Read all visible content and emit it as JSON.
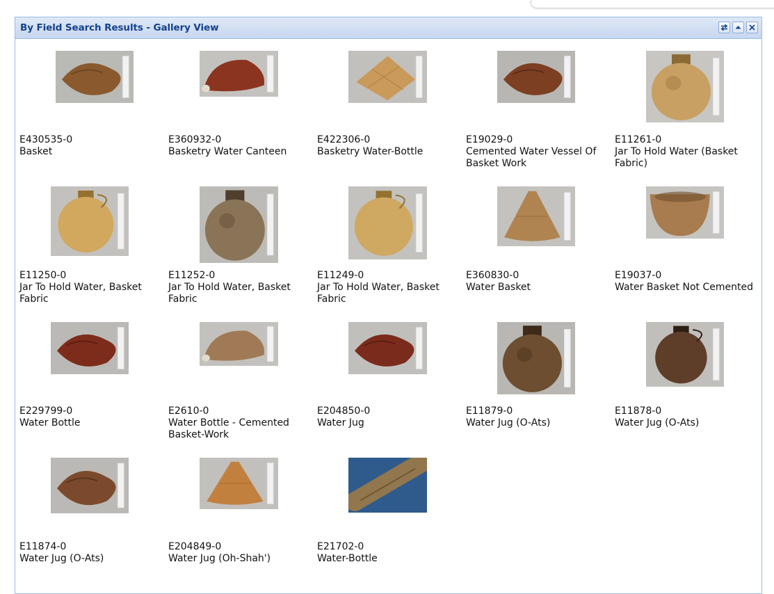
{
  "panel": {
    "title": "By Field Search Results - Gallery View",
    "tools": [
      {
        "name": "refresh-icon"
      },
      {
        "name": "collapse-icon"
      },
      {
        "name": "close-icon"
      }
    ],
    "header_color": "#15428b",
    "border_color": "#99bbe8"
  },
  "items": [
    {
      "number": "E430535-0",
      "name": "Basket",
      "photo": "basket-photo"
    },
    {
      "number": "E360932-0",
      "name": "Basketry Water Canteen",
      "photo": "canteen-photo"
    },
    {
      "number": "E422306-0",
      "name": "Basketry Water-Bottle",
      "photo": "water-bottle-photo"
    },
    {
      "number": "E19029-0",
      "name": "Cemented Water Vessel Of Basket Work",
      "photo": "water-vessel-photo"
    },
    {
      "number": "E11261-0",
      "name": "Jar To Hold Water (Basket Fabric)",
      "photo": "jar-photo"
    },
    {
      "number": "E11250-0",
      "name": "Jar To Hold Water, Basket Fabric",
      "photo": "jar-photo"
    },
    {
      "number": "E11252-0",
      "name": "Jar To Hold Water, Basket Fabric",
      "photo": "jar-photo"
    },
    {
      "number": "E11249-0",
      "name": "Jar To Hold Water, Basket Fabric",
      "photo": "jar-photo"
    },
    {
      "number": "E360830-0",
      "name": "Water Basket",
      "photo": "water-basket-photo"
    },
    {
      "number": "E19037-0",
      "name": "Water Basket Not Cemented",
      "photo": "bowl-basket-photo"
    },
    {
      "number": "E229799-0",
      "name": "Water Bottle",
      "photo": "water-bottle-photo"
    },
    {
      "number": "E2610-0",
      "name": "Water Bottle - Cemented Basket-Work",
      "photo": "water-bottle-photo"
    },
    {
      "number": "E204850-0",
      "name": "Water Jug",
      "photo": "water-jug-photo"
    },
    {
      "number": "E11879-0",
      "name": "Water Jug (O-Ats)",
      "photo": "water-jug-photo"
    },
    {
      "number": "E11878-0",
      "name": "Water Jug (O-Ats)",
      "photo": "water-jug-photo"
    },
    {
      "number": "E11874-0",
      "name": "Water Jug (O-Ats)",
      "photo": "water-jug-photo"
    },
    {
      "number": "E204849-0",
      "name": "Water Jug (Oh-Shah')",
      "photo": "water-jug-photo"
    },
    {
      "number": "E21702-0",
      "name": "Water-Bottle",
      "photo": "water-bottle-photo"
    }
  ]
}
